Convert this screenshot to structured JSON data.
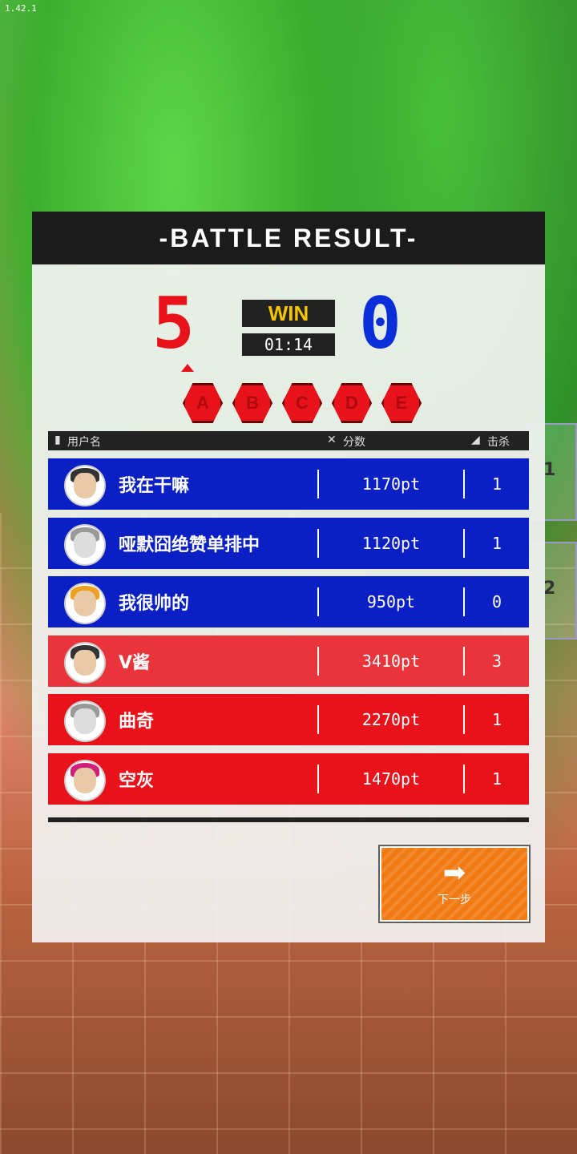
{
  "version": "1.42.1",
  "header": {
    "title": "-BATTLE RESULT-"
  },
  "score": {
    "left": "5",
    "right": "0",
    "result": "WIN",
    "time": "01:14"
  },
  "rounds": [
    "A",
    "B",
    "C",
    "D",
    "E"
  ],
  "columns": {
    "name": "用户名",
    "score": "分数",
    "kills": "击杀"
  },
  "players": [
    {
      "name": "我在干嘛",
      "points": "1170pt",
      "kills": "1",
      "team": "blue"
    },
    {
      "name": "哑默囧绝赞单排中",
      "points": "1120pt",
      "kills": "1",
      "team": "blue"
    },
    {
      "name": "我很帅的",
      "points": "950pt",
      "kills": "0",
      "team": "blue"
    },
    {
      "name": "V酱",
      "points": "3410pt",
      "kills": "3",
      "team": "red"
    },
    {
      "name": "曲奇",
      "points": "2270pt",
      "kills": "1",
      "team": "red"
    },
    {
      "name": "空灰",
      "points": "1470pt",
      "kills": "1",
      "team": "red"
    }
  ],
  "next_button": {
    "label": "下一步"
  },
  "side_tabs": [
    "1",
    "2"
  ],
  "colors": {
    "red_team": "#e8121a",
    "blue_team": "#0b20c4",
    "accent": "#f27a12",
    "win": "#f5c400"
  }
}
